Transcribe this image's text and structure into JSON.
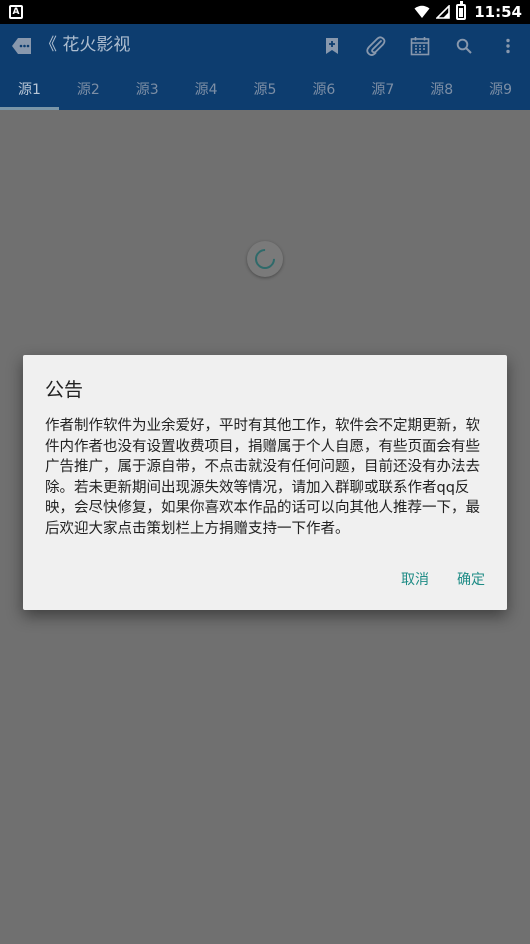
{
  "status_bar": {
    "left_icon": "A",
    "time": "11:54"
  },
  "app_bar": {
    "back_icon": "back-icon",
    "title": "《 花火影视",
    "actions": [
      "bookmark-add-icon",
      "attachment-icon",
      "calendar-icon",
      "search-icon",
      "more-vert-icon"
    ]
  },
  "tabs": [
    "源1",
    "源2",
    "源3",
    "源4",
    "源5",
    "源6",
    "源7",
    "源8",
    "源9"
  ],
  "active_tab": "源1",
  "dialog": {
    "title": "公告",
    "message": "作者制作软件为业余爱好，平时有其他工作，软件会不定期更新，软件内作者也没有设置收费项目，捐赠属于个人自愿，有些页面会有些广告推广，属于源自带，不点击就没有任何问题，目前还没有办法去除。若未更新期间出现源失效等情况，请加入群聊或联系作者qq反映，会尽快修复，如果你喜欢本作品的话可以向其他人推荐一下，最后欢迎大家点击策划栏上方捐赠支持一下作者。",
    "cancel_label": "取消",
    "ok_label": "确定"
  },
  "colors": {
    "appbar": "#0d3d6f",
    "accent": "#1f8c86",
    "scrim": "#707070"
  }
}
